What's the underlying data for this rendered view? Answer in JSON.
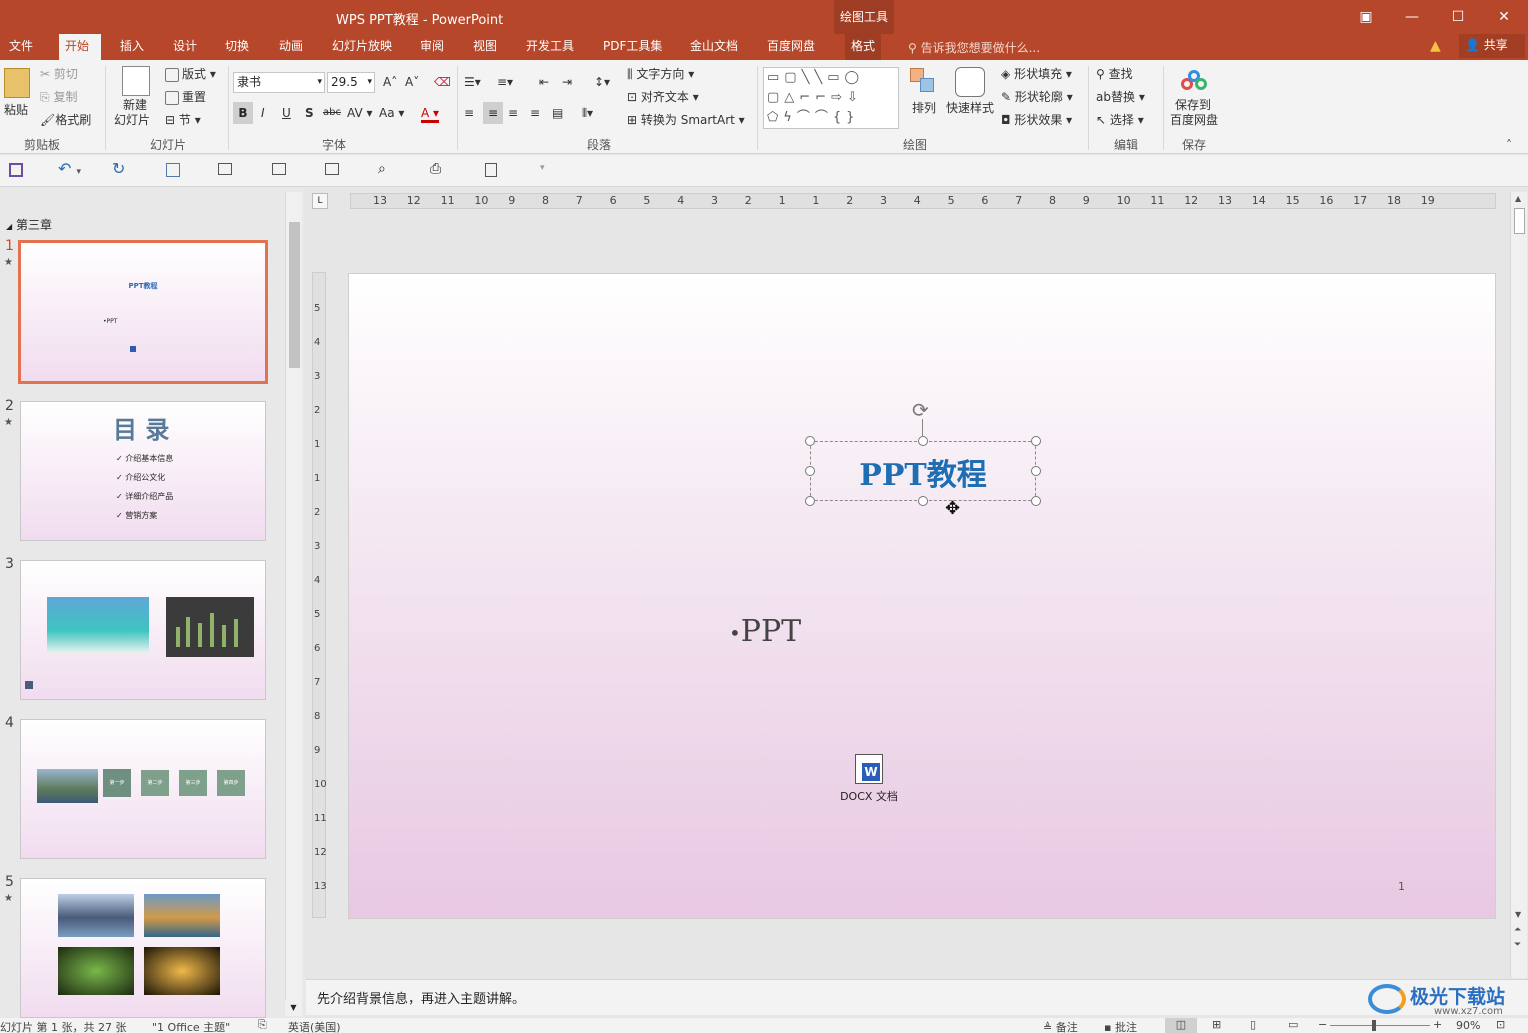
{
  "window": {
    "title": "WPS PPT教程 - PowerPoint",
    "context_tool": "绘图工具"
  },
  "tabs": [
    {
      "label": "文件"
    },
    {
      "label": "开始"
    },
    {
      "label": "插入"
    },
    {
      "label": "设计"
    },
    {
      "label": "切换"
    },
    {
      "label": "动画"
    },
    {
      "label": "幻灯片放映"
    },
    {
      "label": "审阅"
    },
    {
      "label": "视图"
    },
    {
      "label": "开发工具"
    },
    {
      "label": "PDF工具集"
    },
    {
      "label": "金山文档"
    },
    {
      "label": "百度网盘"
    },
    {
      "label": "格式"
    }
  ],
  "tell_me": "告诉我您想要做什么...",
  "share": "共享",
  "ribbon": {
    "clipboard": {
      "paste": "粘贴",
      "cut": "剪切",
      "copy": "复制",
      "format_painter": "格式刷",
      "label": "剪贴板"
    },
    "slides": {
      "new_slide_1": "新建",
      "new_slide_2": "幻灯片",
      "layout": "版式",
      "reset": "重置",
      "section": "节",
      "label": "幻灯片"
    },
    "font": {
      "font_name": "隶书",
      "font_size": "29.5",
      "label": "字体",
      "bold": "B",
      "italic": "I",
      "underline": "U",
      "shadow": "S",
      "strike": "abc",
      "spacing": "AV",
      "case": "Aa",
      "color": "A"
    },
    "paragraph": {
      "text_direction": "文字方向",
      "align_text": "对齐文本",
      "smartart": "转换为 SmartArt",
      "label": "段落"
    },
    "drawing": {
      "arrange": "排列",
      "quick_styles": "快速样式",
      "shape_fill": "形状填充",
      "shape_outline": "形状轮廓",
      "shape_effects": "形状效果",
      "label": "绘图"
    },
    "editing": {
      "find": "查找",
      "replace": "替换",
      "select": "选择",
      "label": "编辑"
    },
    "save": {
      "save_to_1": "保存到",
      "save_to_2": "百度网盘",
      "label": "保存"
    }
  },
  "section": "第三章",
  "thumbnails": [
    {
      "num": "1",
      "star": "★",
      "title": "PPT教程",
      "bullet": "•PPT"
    },
    {
      "num": "2",
      "star": "★",
      "title": "目 录",
      "items": [
        "✓ 介绍基本信息",
        "✓ 介绍公文化",
        "✓ 详细介绍产品",
        "✓ 营销方案"
      ]
    },
    {
      "num": "3",
      "star": ""
    },
    {
      "num": "4",
      "star": "",
      "steps": [
        "第一步",
        "第二步",
        "第三步",
        "第四步"
      ]
    },
    {
      "num": "5",
      "star": "★"
    }
  ],
  "ruler": {
    "h_ticks": [
      "13",
      "12",
      "11",
      "10",
      "9",
      "8",
      "7",
      "6",
      "5",
      "4",
      "3",
      "2",
      "1",
      "1",
      "2",
      "3",
      "4",
      "5",
      "6",
      "7",
      "8",
      "9",
      "10",
      "11",
      "12",
      "13",
      "14",
      "15",
      "16",
      "17",
      "18",
      "19"
    ],
    "v_ticks": [
      "5",
      "4",
      "3",
      "2",
      "1",
      "1",
      "2",
      "3",
      "4",
      "5",
      "6",
      "7",
      "8",
      "9",
      "10",
      "11",
      "12",
      "13"
    ]
  },
  "slide": {
    "title": "PPT教程",
    "bullet": "PPT",
    "object_label": "DOCX 文档",
    "object_icon": "W",
    "page_number": "1"
  },
  "notes": "先介绍背景信息，再进入主题讲解。",
  "status": {
    "slide_info": "幻灯片 第 1 张，共 27 张",
    "theme": "\"1 Office 主题\"",
    "language": "英语(美国)",
    "notes_btn": "备注",
    "comments_btn": "批注",
    "zoom": "90%"
  },
  "watermark": "极光下载站",
  "watermark_url": "www.xz7.com"
}
